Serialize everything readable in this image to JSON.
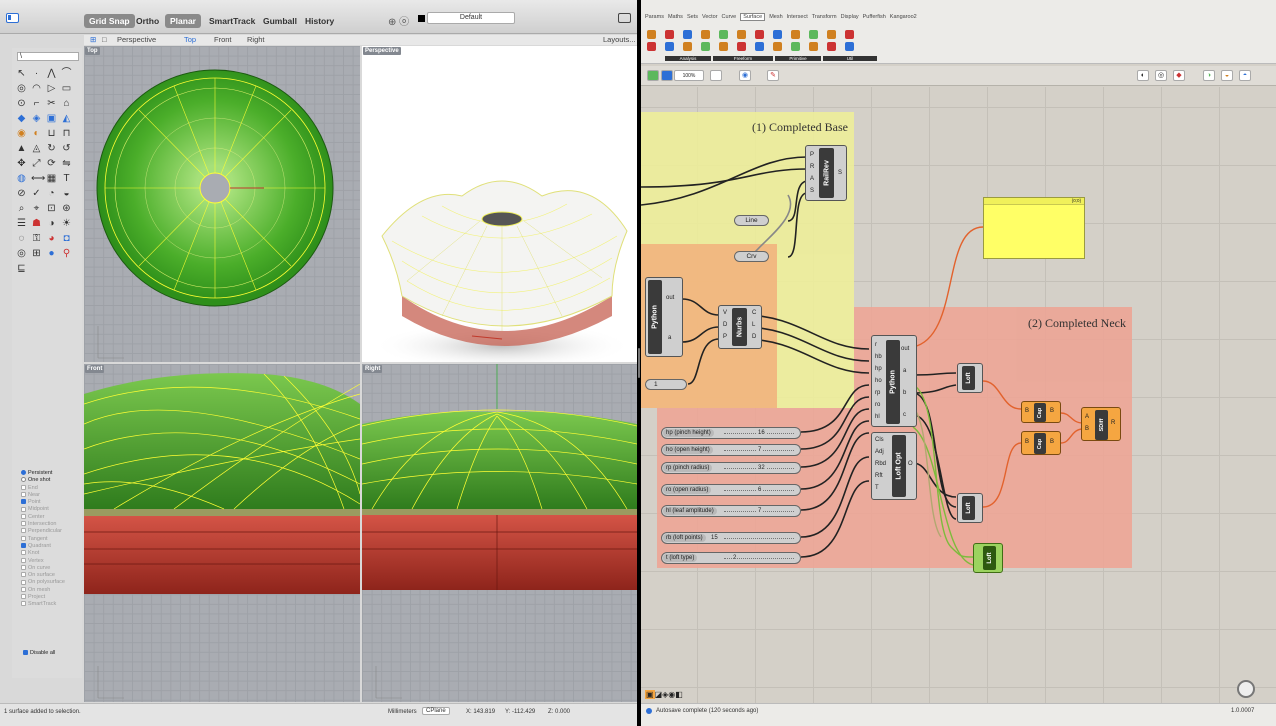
{
  "rhino": {
    "toolbar": {
      "grid_snap": "Grid Snap",
      "ortho": "Ortho",
      "planar": "Planar",
      "smarttrack": "SmartTrack",
      "gumball": "Gumball",
      "history": "History",
      "layer": "Default"
    },
    "view_tabs": {
      "perspective": "Perspective",
      "top": "Top",
      "front": "Front",
      "right": "Right",
      "layouts": "Layouts..."
    },
    "command_prompt": "\\",
    "viewports": {
      "top": "Top",
      "perspective": "Perspective",
      "front": "Front",
      "right": "Right"
    },
    "osnap": {
      "persistent": "Persistent",
      "one_shot": "One shot",
      "items": [
        "End",
        "Near",
        "Point",
        "Midpoint",
        "Center",
        "Intersection",
        "Perpendicular",
        "Tangent",
        "Quadrant",
        "Knot",
        "Vertex",
        "On curve",
        "On surface",
        "On polysurface",
        "On mesh",
        "Project",
        "SmartTrack"
      ],
      "checked": [
        "Point",
        "Quadrant"
      ],
      "disable_all": "Disable all"
    },
    "status": {
      "message": "1 surface added to selection.",
      "units": "Millimeters",
      "cplane": "CPlane",
      "x": "X: 143.819",
      "y": "Y: -112.429",
      "z": "Z: 0.000"
    }
  },
  "grasshopper": {
    "tabs": [
      "Params",
      "Maths",
      "Sets",
      "Vector",
      "Curve",
      "Surface",
      "Mesh",
      "Intersect",
      "Transform",
      "Display",
      "Pufferfish",
      "Kangaroo2"
    ],
    "selected_tab": "Surface",
    "ribbon_groups": [
      "Analysis",
      "Freeform",
      "Primitive",
      "Util"
    ],
    "zoom": "100%",
    "groups": {
      "base": "(1) Completed Base",
      "neck": "(2) Completed Neck"
    },
    "panel_header": "{0;0}",
    "components": {
      "railrev": {
        "name": "RailRev",
        "inputs": [
          "P",
          "R",
          "A",
          "S"
        ],
        "outputs": [
          "S"
        ]
      },
      "line": "Line",
      "crv": "Crv",
      "python_small": {
        "name": "Python",
        "outputs": [
          "out",
          "a"
        ]
      },
      "nurbs": {
        "name": "Nurbs",
        "inputs": [
          "V",
          "D",
          "P"
        ],
        "outputs": [
          "C",
          "L",
          "D"
        ]
      },
      "number": "1",
      "python_main": {
        "name": "Python",
        "inputs": [
          "r",
          "hb",
          "hp",
          "ho",
          "rp",
          "ro",
          "hl"
        ],
        "outputs": [
          "out",
          "a",
          "b",
          "c"
        ]
      },
      "loft_opt": {
        "name": "Loft Opt",
        "inputs": [
          "Cls",
          "Adj",
          "Rbd",
          "Rft",
          "T"
        ],
        "outputs": [
          "O"
        ]
      },
      "loft1": "Loft",
      "loft2": "Loft",
      "loft3": "Loft",
      "cap1": "Cap",
      "cap2": "Cap",
      "sdiff": "SDiff"
    },
    "sliders": [
      {
        "label": "hp (pinch height)",
        "value": "16"
      },
      {
        "label": "ho (open height)",
        "value": "7"
      },
      {
        "label": "rp (pinch radius)",
        "value": "32"
      },
      {
        "label": "ro (open radius)",
        "value": "6"
      },
      {
        "label": "hl (leaf amplitude)",
        "value": "7"
      },
      {
        "label": "rb (loft points)",
        "value": "15"
      },
      {
        "label": "t (loft type)",
        "value": "2"
      }
    ],
    "status": {
      "message": "Autosave complete (120 seconds ago)",
      "version": "1.0.0007"
    }
  },
  "colors": {
    "accent": "#2d6fd6",
    "group_yellow": "#eeee9a",
    "group_orange": "#f2b07b",
    "group_red": "#eda596",
    "panel_yellow": "#ffff66",
    "wire_orange": "#e2622d",
    "wire_green": "#7dbb3c"
  }
}
